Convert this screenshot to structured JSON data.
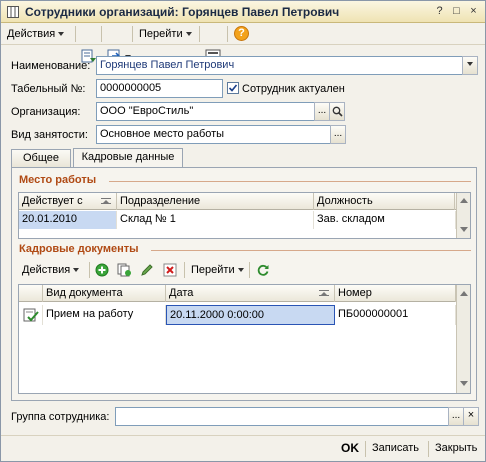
{
  "window": {
    "title": "Сотрудники организаций: Горянцев Павел Петрович",
    "buttons": {
      "help": "?",
      "maximize": "□",
      "close": "×"
    }
  },
  "toolbar": {
    "actions_label": "Действия",
    "goto_label": "Перейти",
    "help_label": "?"
  },
  "form": {
    "name_label": "Наименование:",
    "name_value": "Горянцев Павел Петрович",
    "tabnum_label": "Табельный №:",
    "tabnum_value": "0000000005",
    "actual_label": "Сотрудник актуален",
    "actual_checked": true,
    "org_label": "Организация:",
    "org_value": "ООО \"ЕвроСтиль\"",
    "employment_label": "Вид занятости:",
    "employment_value": "Основное место работы",
    "ellipsis": "...",
    "group_label": "Группа сотрудника:",
    "group_value": ""
  },
  "tabs": [
    {
      "label": "Общее",
      "active": false
    },
    {
      "label": "Кадровые данные",
      "active": true
    }
  ],
  "workplace": {
    "title": "Место работы",
    "columns": [
      "Действует с",
      "Подразделение",
      "Должность"
    ],
    "rows": [
      {
        "date": "20.01.2010",
        "department": "Склад № 1",
        "position": "Зав. складом"
      }
    ]
  },
  "hr_docs": {
    "title": "Кадровые документы",
    "actions_label": "Действия",
    "goto_label": "Перейти",
    "columns": [
      "Вид документа",
      "Дата",
      "Номер"
    ],
    "rows": [
      {
        "type": "Прием на работу",
        "date": "20.11.2000 0:00:00",
        "number": "ПБ000000001"
      }
    ]
  },
  "bottom": {
    "ok": "OK",
    "save": "Записать",
    "close": "Закрыть"
  },
  "colors": {
    "section_title": "#b04a14",
    "selection": "#c8d9f2",
    "link_text": "#1f3a78"
  }
}
